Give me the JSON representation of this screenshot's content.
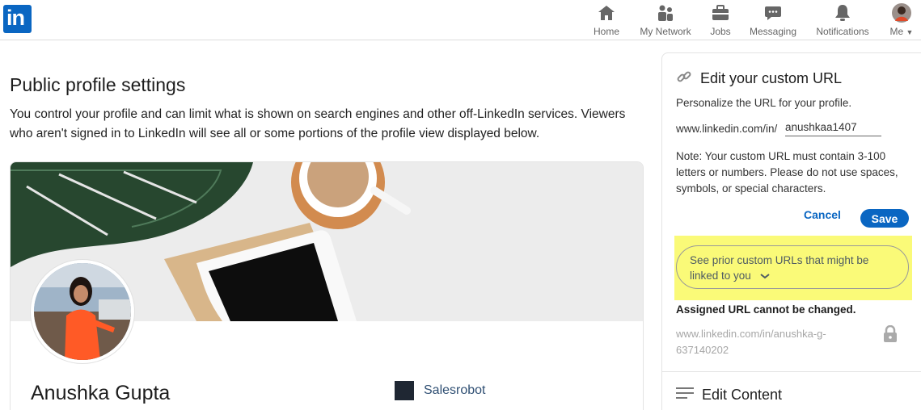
{
  "nav": {
    "logo": "in",
    "items": [
      {
        "label": "Home",
        "icon": "home-icon"
      },
      {
        "label": "My Network",
        "icon": "network-icon"
      },
      {
        "label": "Jobs",
        "icon": "briefcase-icon"
      },
      {
        "label": "Messaging",
        "icon": "chat-icon"
      },
      {
        "label": "Notifications",
        "icon": "bell-icon"
      },
      {
        "label": "Me",
        "icon": "avatar-icon"
      }
    ]
  },
  "main": {
    "title": "Public profile settings",
    "description": "You control your profile and can limit what is shown on search engines and other off-LinkedIn services. Viewers who aren't signed in to LinkedIn will see all or some portions of the profile view displayed below.",
    "profile": {
      "name": "Anushka Gupta",
      "company": "Salesrobot"
    }
  },
  "panel": {
    "title": "Edit your custom URL",
    "subtitle": "Personalize the URL for your profile.",
    "url_prefix": "www.linkedin.com/in/",
    "url_value": "anushkaa1407",
    "note": "Note: Your custom URL must contain 3-100 letters or numbers. Please do not use spaces, symbols, or special characters.",
    "cancel_label": "Cancel",
    "save_label": "Save",
    "prior_urls_label": "See prior custom URLs that might be linked to you",
    "assigned_label": "Assigned URL cannot be changed.",
    "assigned_url": "www.linkedin.com/in/anushka-g-637140202",
    "edit_content_label": "Edit Content"
  },
  "colors": {
    "brand": "#0a66c2",
    "highlight": "#fafa78",
    "nav_text": "#666666"
  }
}
